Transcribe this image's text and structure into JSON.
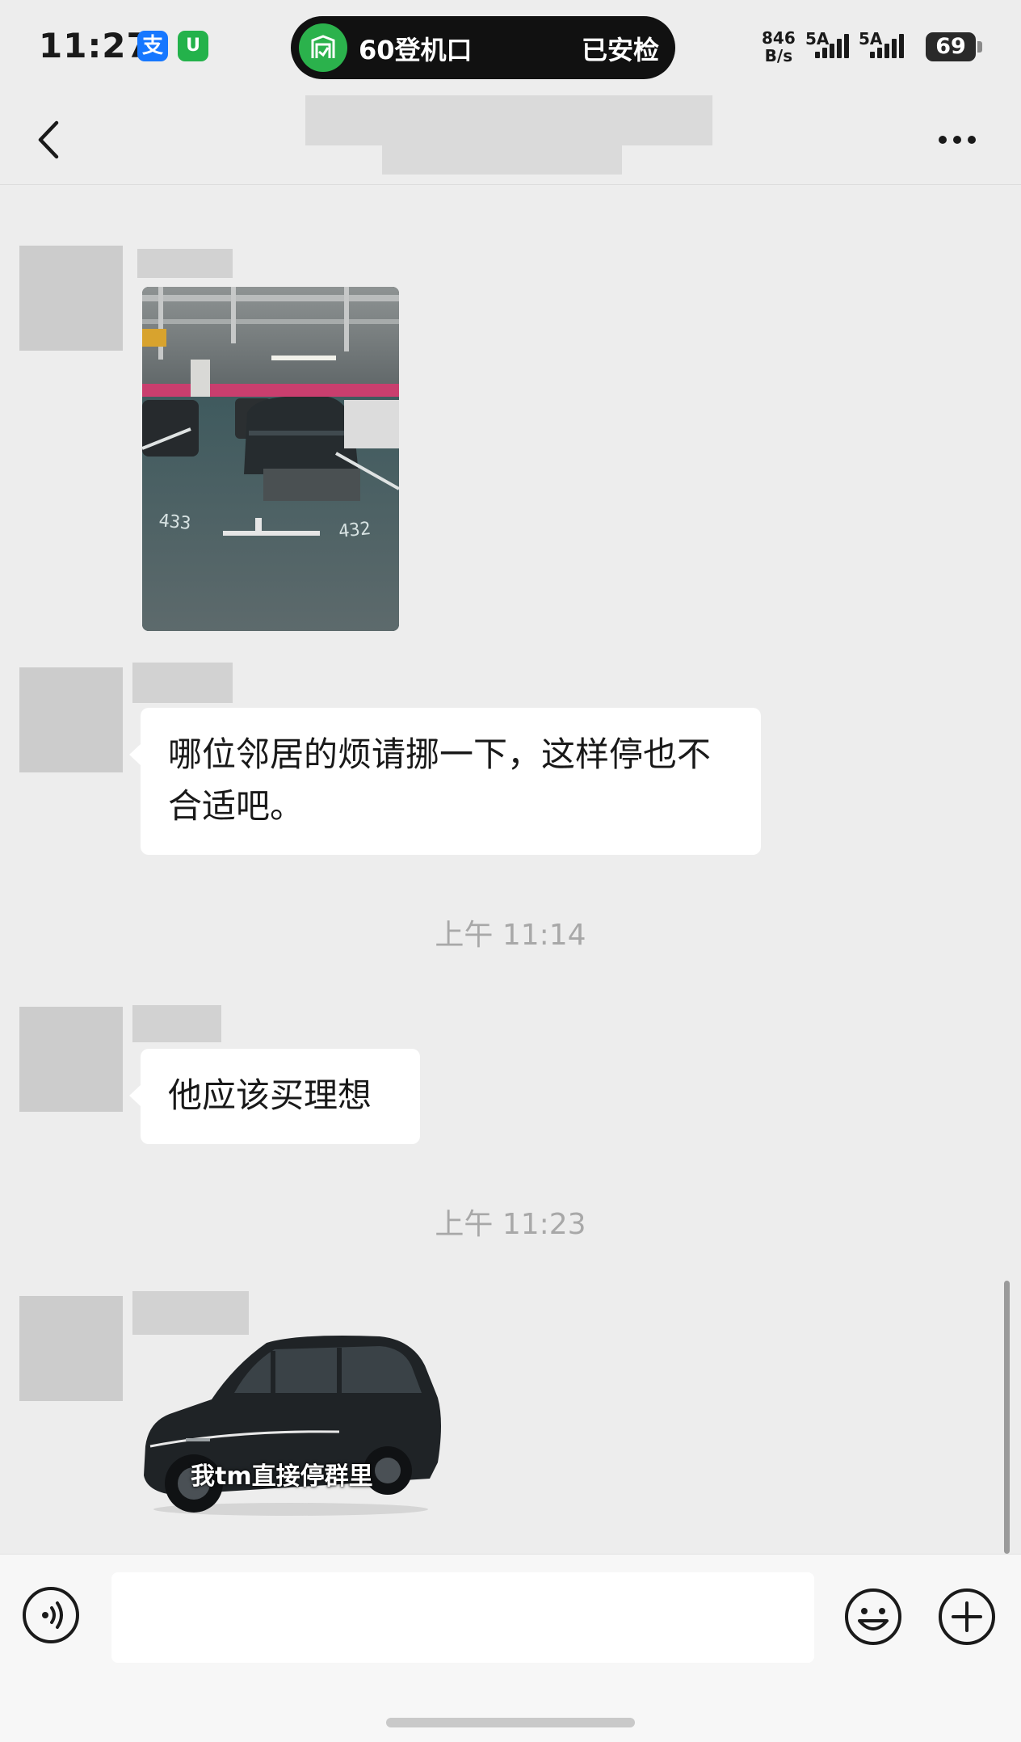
{
  "status_bar": {
    "time": "11:27",
    "alipay_icon_glyph": "支",
    "meituan_icon_glyph": "U",
    "live_activity": {
      "gate": "60登机口",
      "status": "已安检",
      "icon": "gate-icon",
      "accent": "#2bb24c"
    },
    "net_speed_value": "846",
    "net_speed_unit": "B/s",
    "signal_1_label": "5A",
    "signal_2_label": "5A",
    "battery": "69"
  },
  "nav": {
    "back_icon": "chevron-left-icon",
    "more_icon": "more-dots-icon"
  },
  "messages": [
    {
      "type": "image",
      "content": "parking-garage-photo"
    },
    {
      "type": "text",
      "text": "哪位邻居的烦请挪一下，这样停也不合适吧。"
    },
    {
      "type": "time",
      "text": "上午 11:14"
    },
    {
      "type": "text",
      "text": "他应该买理想"
    },
    {
      "type": "time",
      "text": "上午 11:23"
    },
    {
      "type": "sticker",
      "caption": "我tm直接停群里"
    }
  ],
  "photo": {
    "space_left": "433",
    "space_right": "432"
  },
  "input_bar": {
    "voice_icon": "voice-icon",
    "emoji_icon": "emoji-icon",
    "plus_icon": "plus-icon",
    "placeholder": ""
  },
  "colors": {
    "background": "#ededed",
    "bubble": "#ffffff",
    "time_label": "#a8a8a8"
  }
}
